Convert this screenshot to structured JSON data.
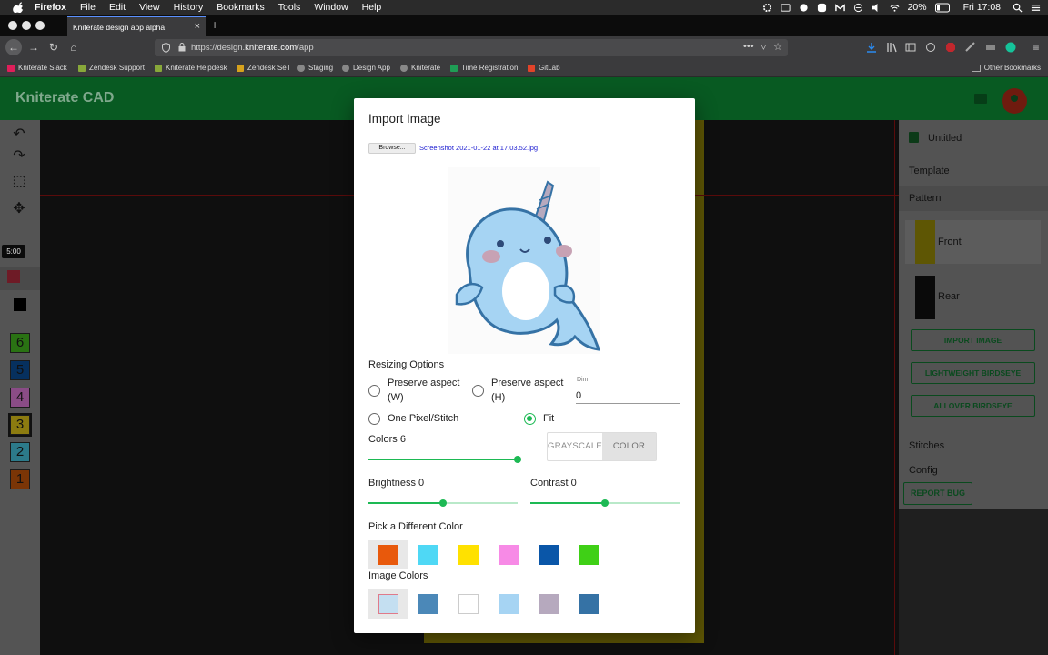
{
  "menubar": {
    "app_name": "Firefox",
    "items": [
      "File",
      "Edit",
      "View",
      "History",
      "Bookmarks",
      "Tools",
      "Window",
      "Help"
    ],
    "battery": "20%",
    "clock": "Fri 17:08"
  },
  "browser": {
    "tab_title": "Kniterate design app alpha",
    "url_prefix": "https://design.",
    "url_domain": "kniterate.com",
    "url_path": "/app",
    "bookmarks": [
      "Kniterate Slack",
      "Zendesk Support",
      "Kniterate Helpdesk",
      "Zendesk Sell",
      "Staging",
      "Design App",
      "Kniterate",
      "Time Registration",
      "GitLab"
    ],
    "other_bookmarks": "Other Bookmarks"
  },
  "app": {
    "title": "Kniterate CAD",
    "time_badge": "5:00",
    "color_slots": [
      "6",
      "5",
      "4",
      "3",
      "2",
      "1"
    ],
    "right_panel": {
      "file_name": "Untitled",
      "template": "Template",
      "pattern": "Pattern",
      "front": "Front",
      "rear": "Rear",
      "import_image": "IMPORT IMAGE",
      "lightweight_birdseye": "LIGHTWEIGHT BIRDSEYE",
      "allover_birdseye": "ALLOVER BIRDSEYE",
      "stitches": "Stitches",
      "config": "Config",
      "report_bug": "REPORT BUG"
    }
  },
  "modal": {
    "title": "Import Image",
    "browse_label": "Browse...",
    "file_name": "Screenshot 2021-01-22 at 17.03.52.jpg",
    "resizing_title": "Resizing Options",
    "opt_preserve_w": "Preserve aspect (W)",
    "opt_preserve_h": "Preserve aspect (H)",
    "dim_label": "Dim",
    "dim_value": "0",
    "opt_one_pixel": "One Pixel/Stitch",
    "opt_fit": "Fit",
    "selected_option": "Fit",
    "colors_label": "Colors 6",
    "colors_value": 6,
    "grayscale_label": "GRAYSCALE",
    "color_label": "COLOR",
    "active_mode": "COLOR",
    "brightness_label": "Brightness 0",
    "brightness_value": 0,
    "contrast_label": "Contrast 0",
    "contrast_value": 0,
    "pick_color_title": "Pick a Different Color",
    "image_colors_title": "Image Colors"
  },
  "colors": {
    "palette": [
      "#e8590c",
      "#4fd8f5",
      "#ffe100",
      "#f78ae6",
      "#0a56a8",
      "#3fd016"
    ],
    "image_colors": [
      "#c4dff1",
      "#4b88b8",
      "#ffffff",
      "#a6d4f3",
      "#b6a9be",
      "#3572a5"
    ],
    "green_accent": "#1db954",
    "canvas_yellow": "#e8d100"
  },
  "icons": {
    "undo": "undo-icon",
    "redo": "redo-icon",
    "select": "select-icon",
    "move": "move-icon",
    "folder": "folder-icon",
    "account": "account-icon",
    "save": "save-icon"
  }
}
